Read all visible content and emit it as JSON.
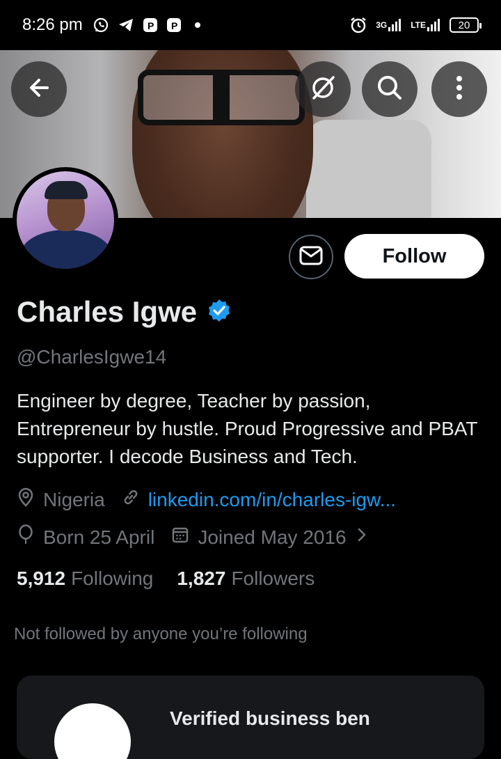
{
  "status_bar": {
    "time": "8:26 pm",
    "left_icons": [
      "whatsapp-icon",
      "telegram-icon",
      "app-p-icon",
      "app-p-icon",
      "dot-icon"
    ],
    "network_1": "3G",
    "network_2": "LTE",
    "battery": "20"
  },
  "header": {
    "back_icon": "arrow-left-icon",
    "grok_icon": "grok-slash-icon",
    "search_icon": "search-icon",
    "more_icon": "more-vertical-icon"
  },
  "profile": {
    "display_name": "Charles Igwe",
    "verified": true,
    "handle": "@CharlesIgwe14",
    "bio": "Engineer by degree, Teacher by passion, Entrepreneur by hustle. Proud Progressive and PBAT supporter. I decode Business and Tech.",
    "location": "Nigeria",
    "website": "linkedin.com/in/charles-igw...",
    "birthday": "Born 25 April",
    "joined": "Joined May 2016",
    "following_count": "5,912",
    "following_label": "Following",
    "followers_count": "1,827",
    "followers_label": "Followers",
    "not_followed_text": "Not followed by anyone you’re following"
  },
  "actions": {
    "follow_label": "Follow",
    "message_icon": "envelope-icon"
  },
  "card": {
    "title": "Verified business ben"
  },
  "colors": {
    "background": "#000000",
    "accent_blue": "#1d9bf0",
    "secondary_text": "#71767b",
    "verified_badge": "#1d9bf0"
  }
}
